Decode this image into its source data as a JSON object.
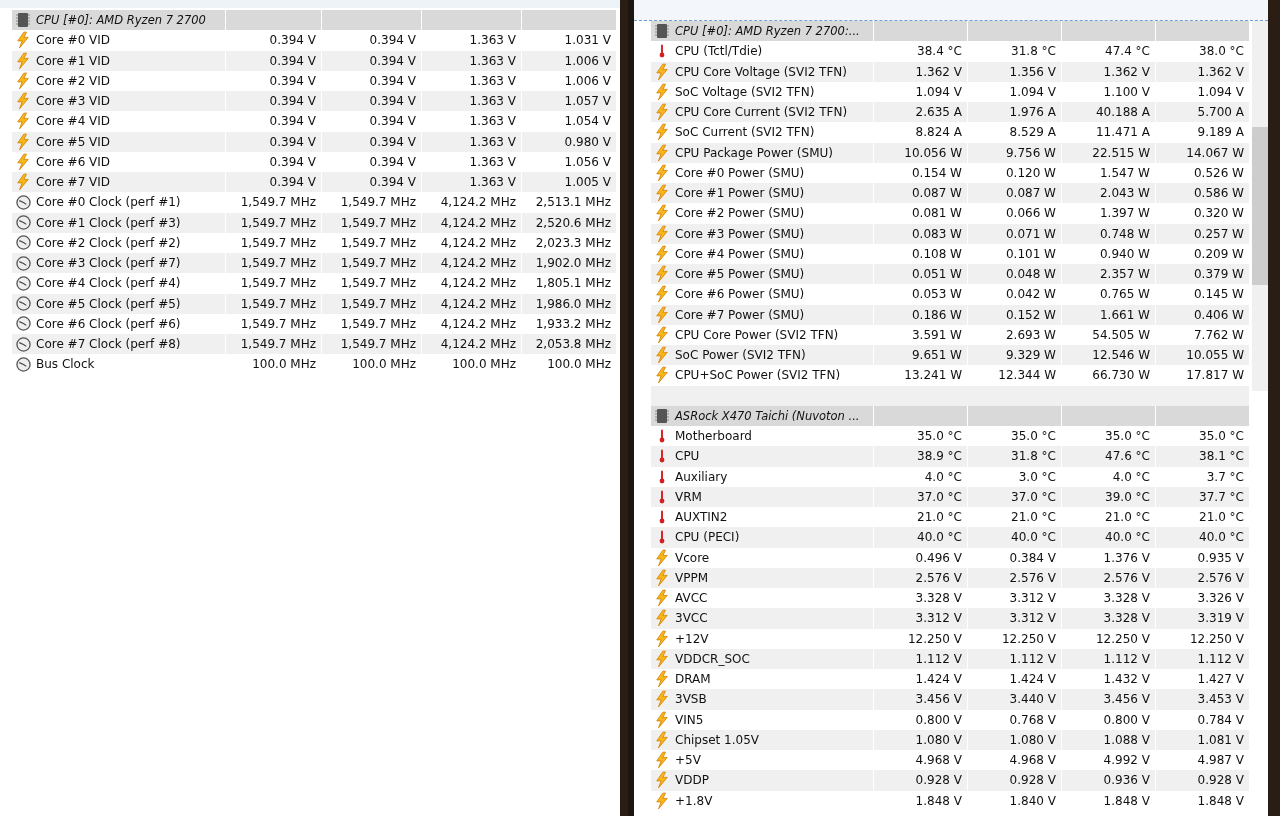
{
  "left_panel": {
    "groups": [
      {
        "title": "CPU [#0]: AMD Ryzen 7 2700",
        "rows": [
          {
            "kind": "voltage",
            "label": "Core #0 VID",
            "values": [
              "0.394 V",
              "0.394 V",
              "1.363 V",
              "1.031 V"
            ]
          },
          {
            "kind": "voltage",
            "label": "Core #1 VID",
            "values": [
              "0.394 V",
              "0.394 V",
              "1.363 V",
              "1.006 V"
            ]
          },
          {
            "kind": "voltage",
            "label": "Core #2 VID",
            "values": [
              "0.394 V",
              "0.394 V",
              "1.363 V",
              "1.006 V"
            ]
          },
          {
            "kind": "voltage",
            "label": "Core #3 VID",
            "values": [
              "0.394 V",
              "0.394 V",
              "1.363 V",
              "1.057 V"
            ]
          },
          {
            "kind": "voltage",
            "label": "Core #4 VID",
            "values": [
              "0.394 V",
              "0.394 V",
              "1.363 V",
              "1.054 V"
            ]
          },
          {
            "kind": "voltage",
            "label": "Core #5 VID",
            "values": [
              "0.394 V",
              "0.394 V",
              "1.363 V",
              "0.980 V"
            ]
          },
          {
            "kind": "voltage",
            "label": "Core #6 VID",
            "values": [
              "0.394 V",
              "0.394 V",
              "1.363 V",
              "1.056 V"
            ]
          },
          {
            "kind": "voltage",
            "label": "Core #7 VID",
            "values": [
              "0.394 V",
              "0.394 V",
              "1.363 V",
              "1.005 V"
            ]
          },
          {
            "kind": "clock",
            "label": "Core #0 Clock (perf #1)",
            "values": [
              "1,549.7 MHz",
              "1,549.7 MHz",
              "4,124.2 MHz",
              "2,513.1 MHz"
            ]
          },
          {
            "kind": "clock",
            "label": "Core #1 Clock (perf #3)",
            "values": [
              "1,549.7 MHz",
              "1,549.7 MHz",
              "4,124.2 MHz",
              "2,520.6 MHz"
            ]
          },
          {
            "kind": "clock",
            "label": "Core #2 Clock (perf #2)",
            "values": [
              "1,549.7 MHz",
              "1,549.7 MHz",
              "4,124.2 MHz",
              "2,023.3 MHz"
            ]
          },
          {
            "kind": "clock",
            "label": "Core #3 Clock (perf #7)",
            "values": [
              "1,549.7 MHz",
              "1,549.7 MHz",
              "4,124.2 MHz",
              "1,902.0 MHz"
            ]
          },
          {
            "kind": "clock",
            "label": "Core #4 Clock (perf #4)",
            "values": [
              "1,549.7 MHz",
              "1,549.7 MHz",
              "4,124.2 MHz",
              "1,805.1 MHz"
            ]
          },
          {
            "kind": "clock",
            "label": "Core #5 Clock (perf #5)",
            "values": [
              "1,549.7 MHz",
              "1,549.7 MHz",
              "4,124.2 MHz",
              "1,986.0 MHz"
            ]
          },
          {
            "kind": "clock",
            "label": "Core #6 Clock (perf #6)",
            "values": [
              "1,549.7 MHz",
              "1,549.7 MHz",
              "4,124.2 MHz",
              "1,933.2 MHz"
            ]
          },
          {
            "kind": "clock",
            "label": "Core #7 Clock (perf #8)",
            "values": [
              "1,549.7 MHz",
              "1,549.7 MHz",
              "4,124.2 MHz",
              "2,053.8 MHz"
            ]
          },
          {
            "kind": "clock",
            "label": "Bus Clock",
            "values": [
              "100.0 MHz",
              "100.0 MHz",
              "100.0 MHz",
              "100.0 MHz"
            ]
          }
        ]
      }
    ]
  },
  "right_panel": {
    "groups": [
      {
        "title": "CPU [#0]: AMD Ryzen 7 2700:...",
        "rows": [
          {
            "kind": "temperature",
            "label": "CPU (Tctl/Tdie)",
            "values": [
              "38.4 °C",
              "31.8 °C",
              "47.4 °C",
              "38.0 °C"
            ]
          },
          {
            "kind": "voltage",
            "label": "CPU Core Voltage (SVI2 TFN)",
            "values": [
              "1.362 V",
              "1.356 V",
              "1.362 V",
              "1.362 V"
            ]
          },
          {
            "kind": "voltage",
            "label": "SoC Voltage (SVI2 TFN)",
            "values": [
              "1.094 V",
              "1.094 V",
              "1.100 V",
              "1.094 V"
            ]
          },
          {
            "kind": "voltage",
            "label": "CPU Core Current (SVI2 TFN)",
            "values": [
              "2.635 A",
              "1.976 A",
              "40.188 A",
              "5.700 A"
            ]
          },
          {
            "kind": "voltage",
            "label": "SoC Current (SVI2 TFN)",
            "values": [
              "8.824 A",
              "8.529 A",
              "11.471 A",
              "9.189 A"
            ]
          },
          {
            "kind": "voltage",
            "label": "CPU Package Power (SMU)",
            "values": [
              "10.056 W",
              "9.756 W",
              "22.515 W",
              "14.067 W"
            ]
          },
          {
            "kind": "voltage",
            "label": "Core #0 Power (SMU)",
            "values": [
              "0.154 W",
              "0.120 W",
              "1.547 W",
              "0.526 W"
            ]
          },
          {
            "kind": "voltage",
            "label": "Core #1 Power (SMU)",
            "values": [
              "0.087 W",
              "0.087 W",
              "2.043 W",
              "0.586 W"
            ]
          },
          {
            "kind": "voltage",
            "label": "Core #2 Power (SMU)",
            "values": [
              "0.081 W",
              "0.066 W",
              "1.397 W",
              "0.320 W"
            ]
          },
          {
            "kind": "voltage",
            "label": "Core #3 Power (SMU)",
            "values": [
              "0.083 W",
              "0.071 W",
              "0.748 W",
              "0.257 W"
            ]
          },
          {
            "kind": "voltage",
            "label": "Core #4 Power (SMU)",
            "values": [
              "0.108 W",
              "0.101 W",
              "0.940 W",
              "0.209 W"
            ]
          },
          {
            "kind": "voltage",
            "label": "Core #5 Power (SMU)",
            "values": [
              "0.051 W",
              "0.048 W",
              "2.357 W",
              "0.379 W"
            ]
          },
          {
            "kind": "voltage",
            "label": "Core #6 Power (SMU)",
            "values": [
              "0.053 W",
              "0.042 W",
              "0.765 W",
              "0.145 W"
            ]
          },
          {
            "kind": "voltage",
            "label": "Core #7 Power (SMU)",
            "values": [
              "0.186 W",
              "0.152 W",
              "1.661 W",
              "0.406 W"
            ]
          },
          {
            "kind": "voltage",
            "label": "CPU Core Power (SVI2 TFN)",
            "values": [
              "3.591 W",
              "2.693 W",
              "54.505 W",
              "7.762 W"
            ]
          },
          {
            "kind": "voltage",
            "label": "SoC Power (SVI2 TFN)",
            "values": [
              "9.651 W",
              "9.329 W",
              "12.546 W",
              "10.055 W"
            ]
          },
          {
            "kind": "voltage",
            "label": "CPU+SoC Power (SVI2 TFN)",
            "values": [
              "13.241 W",
              "12.344 W",
              "66.730 W",
              "17.817 W"
            ]
          }
        ]
      },
      {
        "title": "ASRock X470 Taichi (Nuvoton ...",
        "rows": [
          {
            "kind": "temperature",
            "label": "Motherboard",
            "values": [
              "35.0 °C",
              "35.0 °C",
              "35.0 °C",
              "35.0 °C"
            ]
          },
          {
            "kind": "temperature",
            "label": "CPU",
            "values": [
              "38.9 °C",
              "31.8 °C",
              "47.6 °C",
              "38.1 °C"
            ]
          },
          {
            "kind": "temperature",
            "label": "Auxiliary",
            "values": [
              "4.0 °C",
              "3.0 °C",
              "4.0 °C",
              "3.7 °C"
            ]
          },
          {
            "kind": "temperature",
            "label": "VRM",
            "values": [
              "37.0 °C",
              "37.0 °C",
              "39.0 °C",
              "37.7 °C"
            ]
          },
          {
            "kind": "temperature",
            "label": "AUXTIN2",
            "values": [
              "21.0 °C",
              "21.0 °C",
              "21.0 °C",
              "21.0 °C"
            ]
          },
          {
            "kind": "temperature",
            "label": "CPU (PECI)",
            "values": [
              "40.0 °C",
              "40.0 °C",
              "40.0 °C",
              "40.0 °C"
            ]
          },
          {
            "kind": "voltage",
            "label": "Vcore",
            "values": [
              "0.496 V",
              "0.384 V",
              "1.376 V",
              "0.935 V"
            ]
          },
          {
            "kind": "voltage",
            "label": "VPPM",
            "values": [
              "2.576 V",
              "2.576 V",
              "2.576 V",
              "2.576 V"
            ]
          },
          {
            "kind": "voltage",
            "label": "AVCC",
            "values": [
              "3.328 V",
              "3.312 V",
              "3.328 V",
              "3.326 V"
            ]
          },
          {
            "kind": "voltage",
            "label": "3VCC",
            "values": [
              "3.312 V",
              "3.312 V",
              "3.328 V",
              "3.319 V"
            ]
          },
          {
            "kind": "voltage",
            "label": "+12V",
            "values": [
              "12.250 V",
              "12.250 V",
              "12.250 V",
              "12.250 V"
            ]
          },
          {
            "kind": "voltage",
            "label": "VDDCR_SOC",
            "values": [
              "1.112 V",
              "1.112 V",
              "1.112 V",
              "1.112 V"
            ]
          },
          {
            "kind": "voltage",
            "label": "DRAM",
            "values": [
              "1.424 V",
              "1.424 V",
              "1.432 V",
              "1.427 V"
            ]
          },
          {
            "kind": "voltage",
            "label": "3VSB",
            "values": [
              "3.456 V",
              "3.440 V",
              "3.456 V",
              "3.453 V"
            ]
          },
          {
            "kind": "voltage",
            "label": "VIN5",
            "values": [
              "0.800 V",
              "0.768 V",
              "0.800 V",
              "0.784 V"
            ]
          },
          {
            "kind": "voltage",
            "label": "Chipset 1.05V",
            "values": [
              "1.080 V",
              "1.080 V",
              "1.088 V",
              "1.081 V"
            ]
          },
          {
            "kind": "voltage",
            "label": "+5V",
            "values": [
              "4.968 V",
              "4.968 V",
              "4.992 V",
              "4.987 V"
            ]
          },
          {
            "kind": "voltage",
            "label": "VDDP",
            "values": [
              "0.928 V",
              "0.928 V",
              "0.936 V",
              "0.928 V"
            ]
          },
          {
            "kind": "voltage",
            "label": "+1.8V",
            "values": [
              "1.848 V",
              "1.840 V",
              "1.848 V",
              "1.848 V"
            ]
          }
        ]
      }
    ]
  }
}
